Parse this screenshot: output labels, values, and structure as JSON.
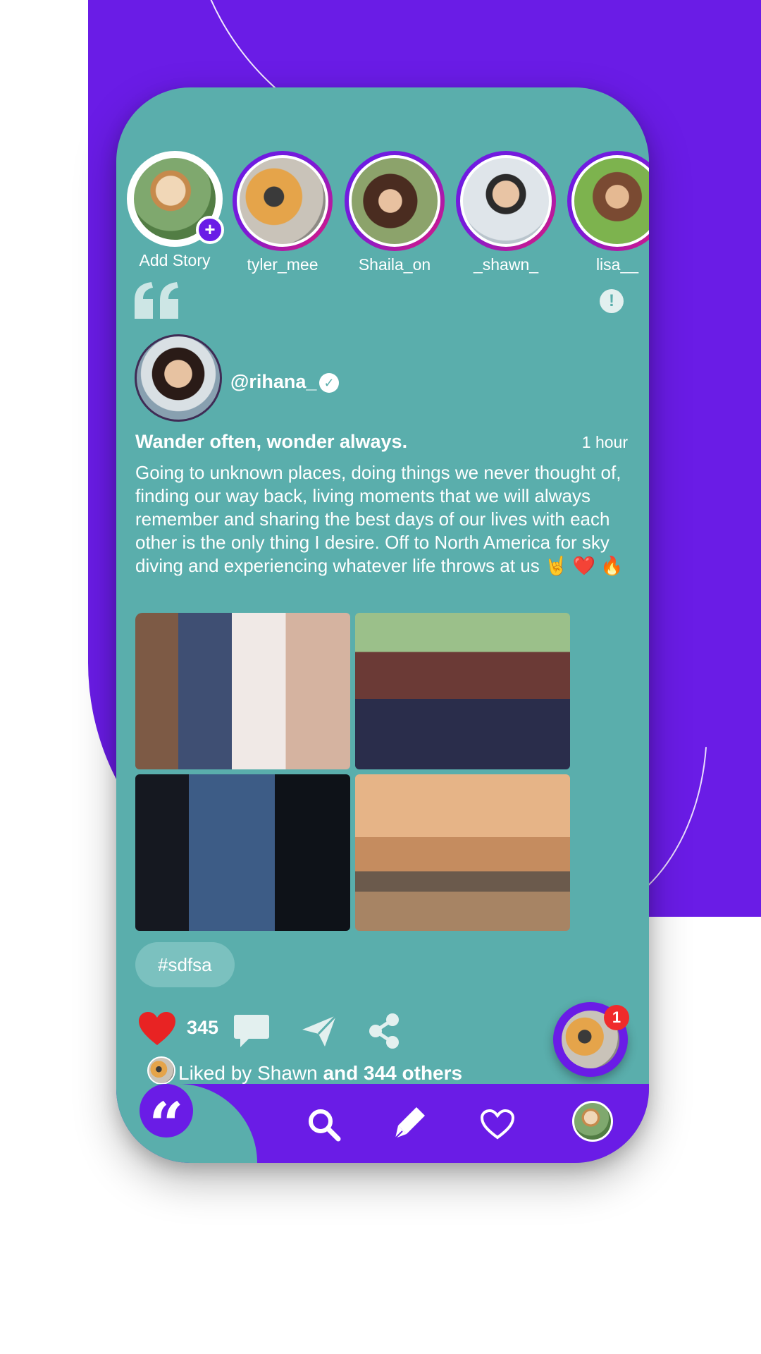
{
  "stories": [
    {
      "name": "Add Story"
    },
    {
      "name": "tyler_mee"
    },
    {
      "name": "Shaila_on"
    },
    {
      "name": "_shawn_"
    },
    {
      "name": "lisa__"
    }
  ],
  "post": {
    "username": "@rihana_",
    "title": "Wander often, wonder always.",
    "time": "1 hour",
    "body": "Going to unknown places, doing things we never thought of, finding our way back, living moments that we will always remember and sharing the best days of our lives with each other is the only thing I desire. Off to North America for sky diving and experiencing whatever life throws at us",
    "emojis": "🤘 ❤️ 🔥",
    "hashtag": "#sdfsa",
    "like_count": "345",
    "liked_by_prefix": "Liked by Shawn",
    "liked_by_suffix": "and 344 others"
  },
  "fab": {
    "badge": "1"
  },
  "colors": {
    "accent": "#6a1ce6",
    "card": "#5aaeac",
    "heart": "#e82323"
  }
}
